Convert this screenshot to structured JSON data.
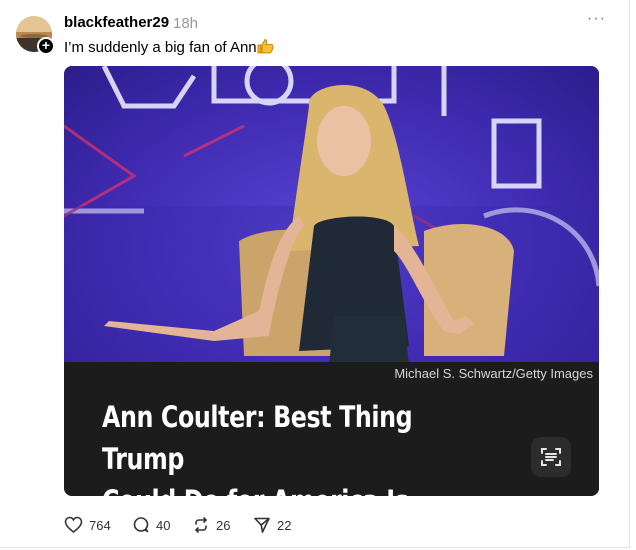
{
  "post": {
    "username": "blackfeather29",
    "time": "18h",
    "more_label": "···",
    "text": "I’m suddenly a big fan of Ann",
    "avatar_plus": "+"
  },
  "media": {
    "credit": "Michael S. Schwartz/Getty Images",
    "headline_line1": "Ann Coulter: Best Thing Trump",
    "headline_line2": "Could Do for America Is ‘Die’"
  },
  "actions": {
    "likes": "764",
    "comments": "40",
    "reposts": "26",
    "shares": "22"
  },
  "colors": {
    "stage_purple": "#4330b8",
    "caption_black": "#1c1c1c",
    "muted_text": "#999999"
  },
  "icons": [
    "thumbs-up-emoji",
    "heart-icon",
    "comment-icon",
    "repost-icon",
    "share-icon",
    "lens-icon",
    "more-icon"
  ]
}
